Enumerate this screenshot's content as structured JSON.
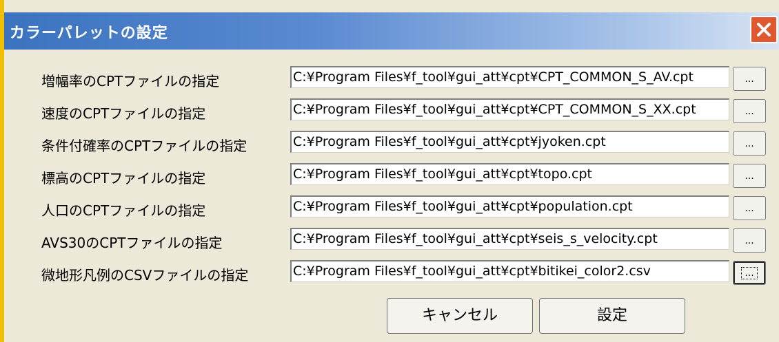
{
  "window": {
    "title": "カラーパレットの設定"
  },
  "rows": [
    {
      "label": "増幅率のCPTファイルの指定",
      "path": "C:¥Program Files¥f_tool¥gui_att¥cpt¥CPT_COMMON_S_AV.cpt",
      "browse": "..."
    },
    {
      "label": "速度のCPTファイルの指定",
      "path": "C:¥Program Files¥f_tool¥gui_att¥cpt¥CPT_COMMON_S_XX.cpt",
      "browse": "..."
    },
    {
      "label": "条件付確率のCPTファイルの指定",
      "path": "C:¥Program Files¥f_tool¥gui_att¥cpt¥jyoken.cpt",
      "browse": "..."
    },
    {
      "label": "標高のCPTファイルの指定",
      "path": "C:¥Program Files¥f_tool¥gui_att¥cpt¥topo.cpt",
      "browse": "..."
    },
    {
      "label": "人口のCPTファイルの指定",
      "path": "C:¥Program Files¥f_tool¥gui_att¥cpt¥population.cpt",
      "browse": "..."
    },
    {
      "label": "AVS30のCPTファイルの指定",
      "path": "C:¥Program Files¥f_tool¥gui_att¥cpt¥seis_s_velocity.cpt",
      "browse": "..."
    },
    {
      "label": "微地形凡例のCSVファイルの指定",
      "path": "C:¥Program Files¥f_tool¥gui_att¥cpt¥bitikei_color2.csv",
      "browse": "..."
    }
  ],
  "buttons": {
    "cancel": "キャンセル",
    "ok": "設定"
  }
}
